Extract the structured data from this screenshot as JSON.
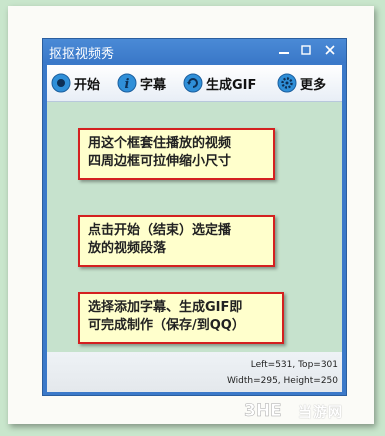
{
  "window": {
    "title": "抠抠视频秀"
  },
  "toolbar": {
    "items": [
      {
        "label": "开始",
        "icon": "play-icon"
      },
      {
        "label": "字幕",
        "icon": "info-icon"
      },
      {
        "label": "生成GIF",
        "icon": "refresh-icon"
      },
      {
        "label": "更多",
        "icon": "gear-icon"
      }
    ]
  },
  "notes": [
    {
      "line1": "用这个框套住播放的视频",
      "line2": "四周边框可拉伸缩小尺寸"
    },
    {
      "line1": "点击开始（结束）选定播",
      "line2": "放的视频段落"
    },
    {
      "line1": "选择添加字幕、生成GIF即",
      "line2": "可完成制作（保存/到QQ）"
    }
  ],
  "status": {
    "position": "Left=531, Top=301",
    "size": "Width=295, Height=250"
  },
  "watermark": {
    "text": "当游网"
  }
}
